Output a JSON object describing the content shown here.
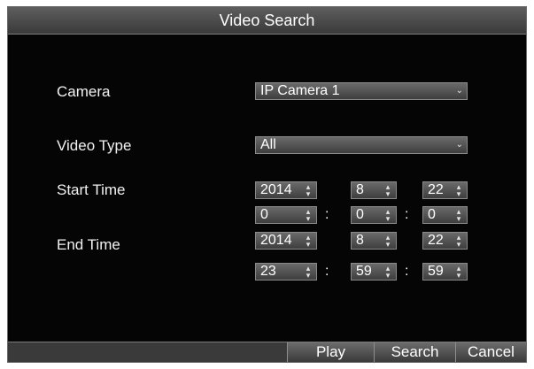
{
  "dialog": {
    "title": "Video Search"
  },
  "camera": {
    "label": "Camera",
    "value": "IP Camera 1",
    "icon": "chevron-down-icon"
  },
  "video_type": {
    "label": "Video Type",
    "value": "All",
    "icon": "chevron-down-icon"
  },
  "start_time": {
    "label": "Start Time",
    "year": "2014",
    "month": "8",
    "day": "22",
    "hour": "0",
    "minute": "0",
    "second": "0"
  },
  "end_time": {
    "label": "End Time",
    "year": "2014",
    "month": "8",
    "day": "22",
    "hour": "23",
    "minute": "59",
    "second": "59"
  },
  "time_separator": ":",
  "buttons": {
    "play": "Play",
    "search": "Search",
    "cancel": "Cancel"
  },
  "colors": {
    "background": "#050505",
    "title_bar": "#4a4a4a",
    "field": "#555555",
    "text": "#ffffff"
  }
}
